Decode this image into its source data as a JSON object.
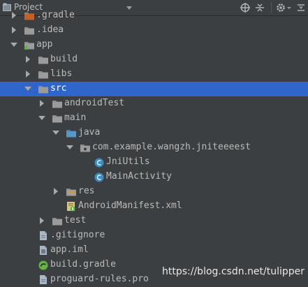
{
  "header": {
    "title": "Project"
  },
  "tree": [
    {
      "label": ".gradle",
      "arrow": "right",
      "icon": "folder-gradle-icon"
    },
    {
      "label": ".idea",
      "arrow": "right",
      "icon": "folder-icon"
    },
    {
      "label": "app",
      "arrow": "down",
      "icon": "module-folder-icon"
    },
    {
      "label": "build",
      "arrow": "right",
      "icon": "folder-icon"
    },
    {
      "label": "libs",
      "arrow": "right",
      "icon": "folder-icon"
    },
    {
      "label": "src",
      "arrow": "down",
      "icon": "folder-icon",
      "selected": true
    },
    {
      "label": "androidTest",
      "arrow": "right",
      "icon": "folder-icon"
    },
    {
      "label": "main",
      "arrow": "down",
      "icon": "folder-icon"
    },
    {
      "label": "java",
      "arrow": "down",
      "icon": "source-folder-icon"
    },
    {
      "label": "com.example.wangzh.jniteeeest",
      "arrow": "down",
      "icon": "package-icon"
    },
    {
      "label": "JniUtils",
      "arrow": "none",
      "icon": "class-icon"
    },
    {
      "label": "MainActivity",
      "arrow": "none",
      "icon": "class-icon"
    },
    {
      "label": "res",
      "arrow": "right",
      "icon": "resources-folder-icon"
    },
    {
      "label": "AndroidManifest.xml",
      "arrow": "none",
      "icon": "manifest-icon"
    },
    {
      "label": "test",
      "arrow": "right",
      "icon": "folder-icon"
    },
    {
      "label": ".gitignore",
      "arrow": "none",
      "icon": "text-file-icon"
    },
    {
      "label": "app.iml",
      "arrow": "none",
      "icon": "iml-file-icon"
    },
    {
      "label": "build.gradle",
      "arrow": "none",
      "icon": "gradle-file-icon"
    },
    {
      "label": "proguard-rules.pro",
      "arrow": "none",
      "icon": "text-file-icon"
    }
  ],
  "watermark": "https://blog.csdn.net/tulipper",
  "colors": {
    "selection": "#2f65ca",
    "background": "#3c3f41",
    "folder": "#8c8c8c",
    "source_folder": "#5897c4",
    "class_icon": "#3a8ec2"
  }
}
